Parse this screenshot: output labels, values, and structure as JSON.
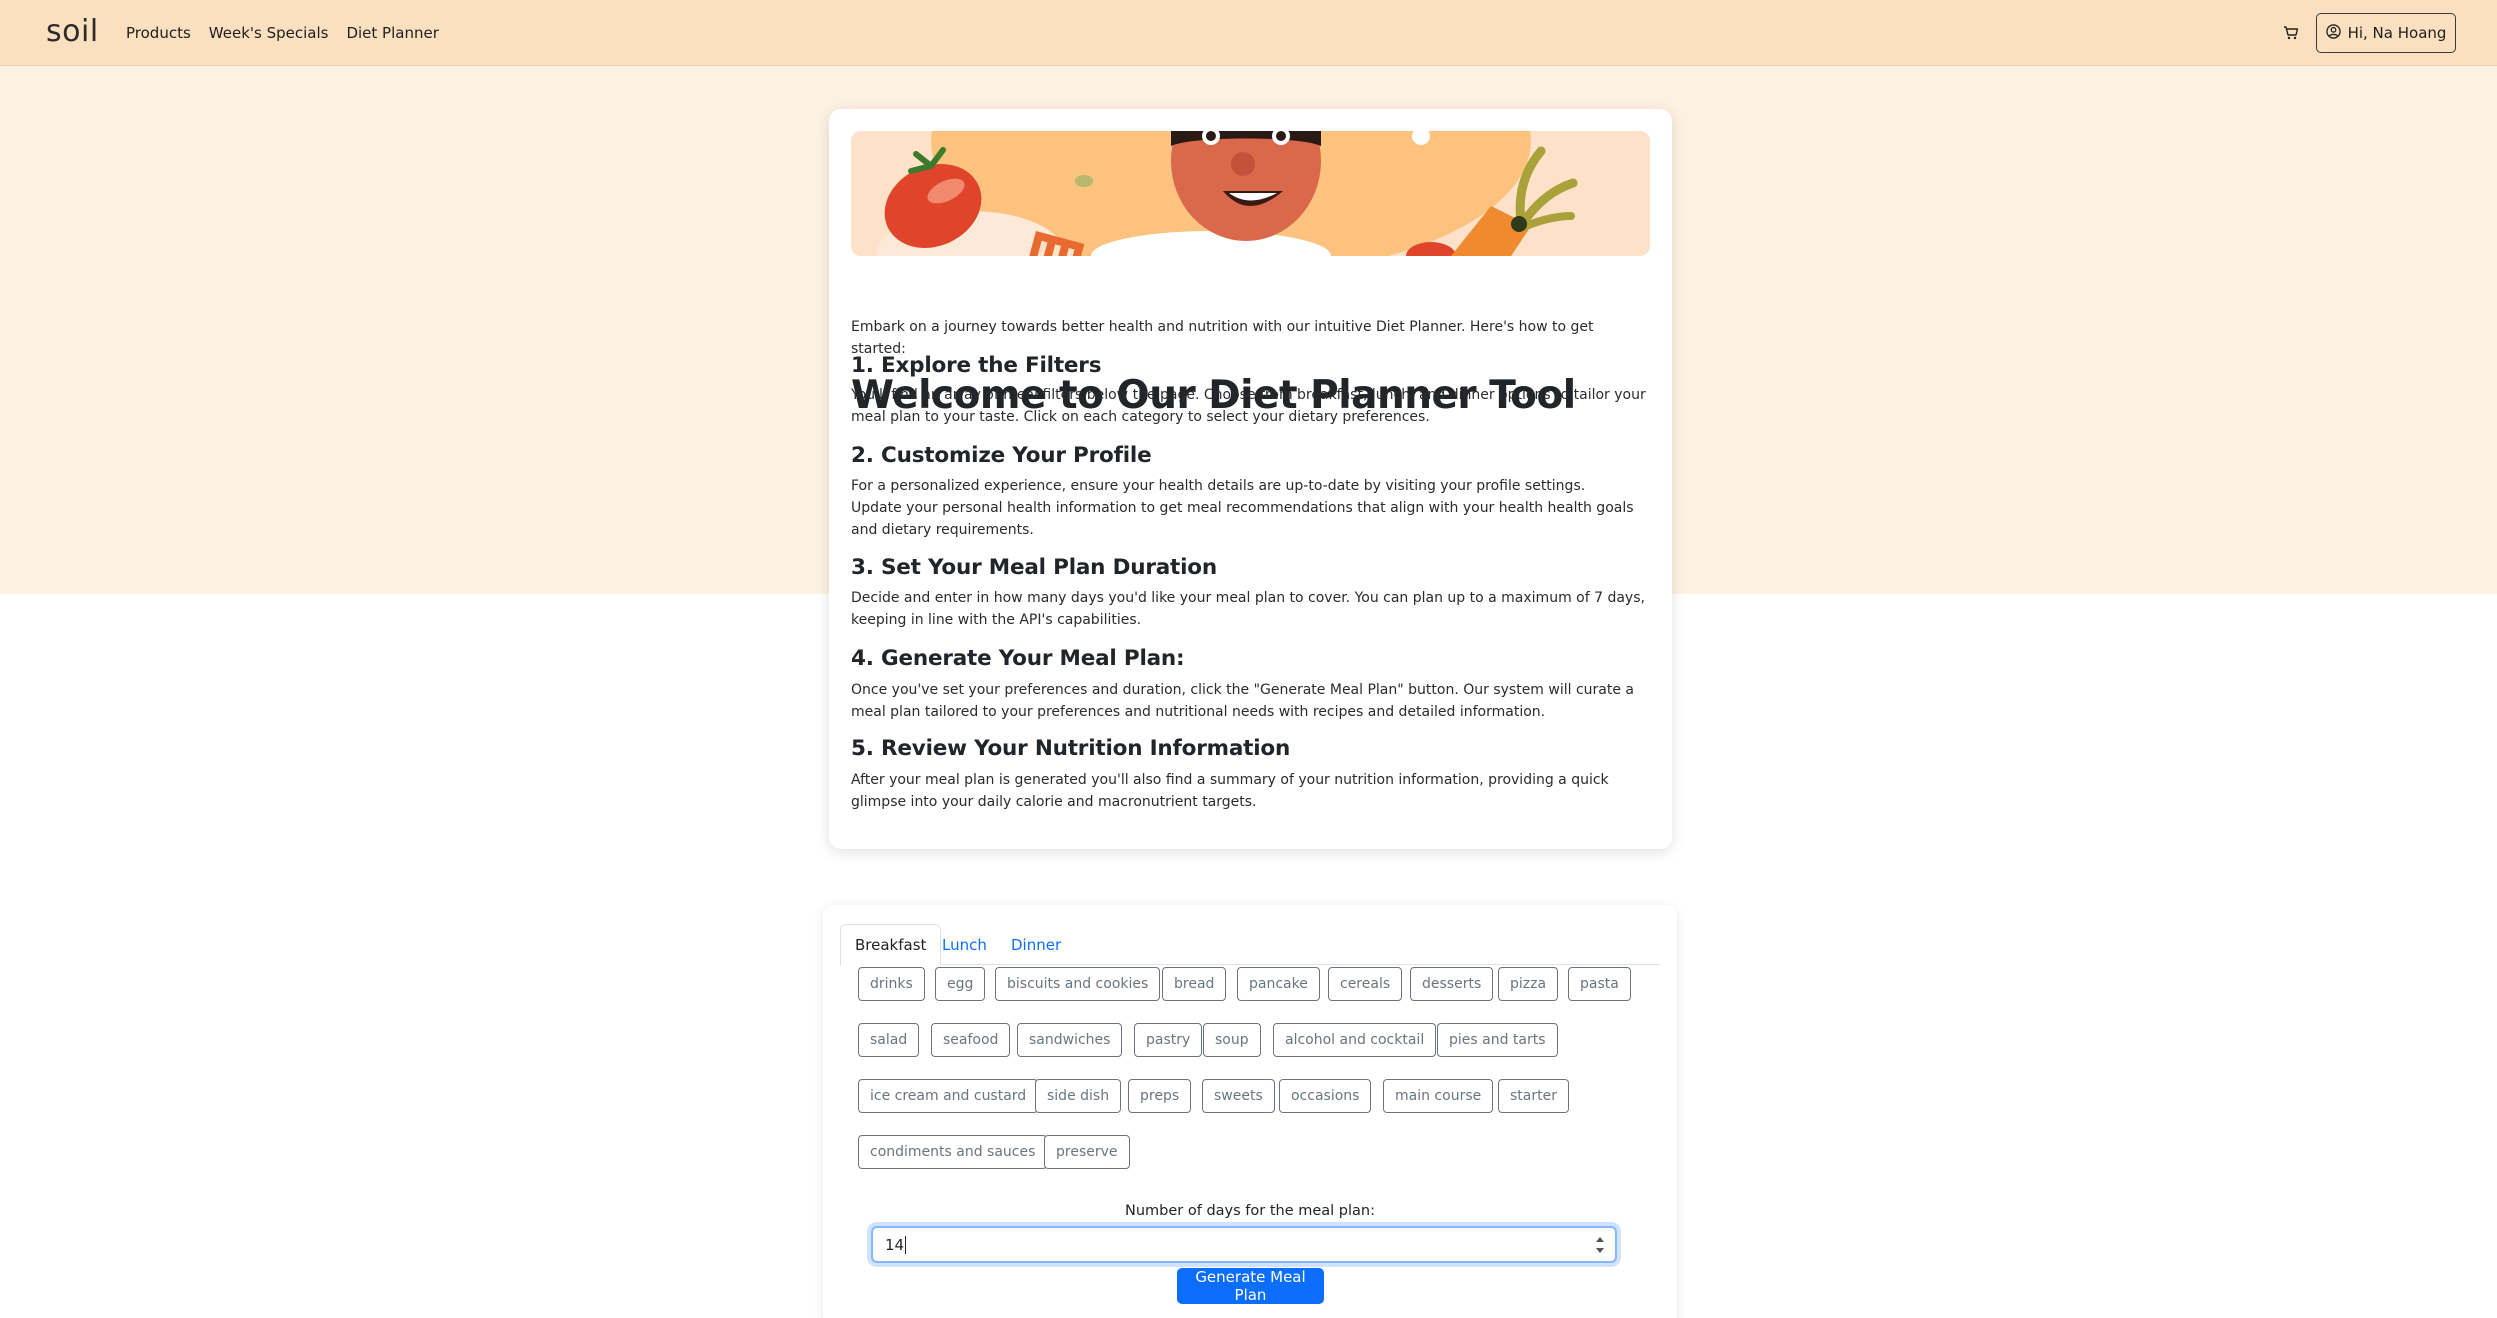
{
  "navbar": {
    "brand": "soil",
    "links": [
      "Products",
      "Week's Specials",
      "Diet Planner"
    ],
    "cart_icon": "cart-icon",
    "user_label": "Hi, Na Hoang",
    "user_icon": "user-circle-icon"
  },
  "intro": {
    "title": "Welcome to Our Diet Planner Tool",
    "lead": "Embark on a journey towards better health and nutrition with our intuitive Diet Planner. Here's how to get started:",
    "steps": [
      {
        "heading": "1. Explore the Filters",
        "text": "You'll find an array of meal filters below the page. Choose from breakfast, lunch, and dinner options to tailor your meal plan to your taste. Click on each category to select your dietary preferences."
      },
      {
        "heading": "2. Customize Your Profile",
        "text": "For a personalized experience, ensure your health details are up-to-date by visiting your profile settings.",
        "text2": "Update your personal health information to get meal recommendations that align with your health health goals and dietary requirements."
      },
      {
        "heading": "3. Set Your Meal Plan Duration",
        "text": "Decide and enter in how many days you'd like your meal plan to cover. You can plan up to a maximum of 7 days, keeping in line with the API's capabilities."
      },
      {
        "heading": "4. Generate Your Meal Plan:",
        "text": "Once you've set your preferences and duration, click the \"Generate Meal Plan\" button. Our system will curate a meal plan tailored to your preferences and nutritional needs with recipes and detailed information."
      },
      {
        "heading": "5. Review Your Nutrition Information",
        "text": "After your meal plan is generated you'll also find a summary of your nutrition information, providing a quick glimpse into your daily calorie and macronutrient targets."
      }
    ]
  },
  "filters": {
    "tabs": [
      "Breakfast",
      "Lunch",
      "Dinner"
    ],
    "active_tab": "Breakfast",
    "chips": [
      "drinks",
      "egg",
      "biscuits and cookies",
      "bread",
      "pancake",
      "cereals",
      "desserts",
      "pizza",
      "pasta",
      "salad",
      "seafood",
      "sandwiches",
      "pastry",
      "soup",
      "alcohol and cocktail",
      "pies and tarts",
      "ice cream and custard",
      "side dish",
      "preps",
      "sweets",
      "occasions",
      "main course",
      "starter",
      "condiments and sauces",
      "preserve"
    ],
    "days_label": "Number of days for the meal plan:",
    "days_value": "14",
    "generate_label": "Generate Meal Plan"
  },
  "colors": {
    "navbar_bg": "#fae0bf",
    "page_top_bg": "#fdf1e1",
    "primary": "#0d6efd",
    "chip_border": "#6c757d"
  }
}
